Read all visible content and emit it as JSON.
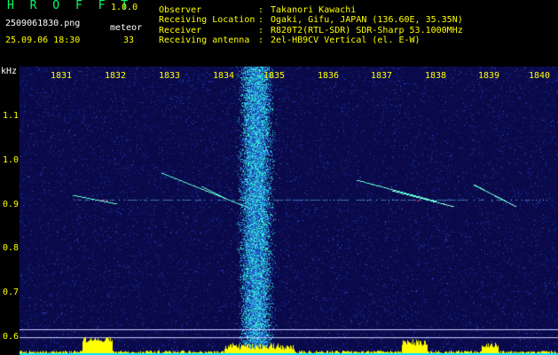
{
  "header": {
    "brand": "H R O F F T",
    "version": "1.0.0",
    "filename": "2509061830.png",
    "meteor_label": "meteor",
    "datetime": "25.09.06 18:30",
    "meteor_count": "33",
    "info": [
      {
        "key": "Observer",
        "value": "Takanori Kawachi"
      },
      {
        "key": "Receiving Location",
        "value": "Ogaki, Gifu, JAPAN (136.60E, 35.35N)"
      },
      {
        "key": "Receiver",
        "value": "R820T2(RTL-SDR) SDR-Sharp 53.1000MHz"
      },
      {
        "key": "Receiving antenna",
        "value": "2el-HB9CV Vertical (el. E-W)"
      }
    ],
    "colon": ":"
  },
  "spectrogram": {
    "unit": "kHz",
    "time_ticks": [
      "1831",
      "1832",
      "1833",
      "1834",
      "1835",
      "1836",
      "1837",
      "1838",
      "1839",
      "1840"
    ],
    "freq_ticks": [
      "1.1",
      "1.0",
      "0.9",
      "0.8",
      "0.7",
      "0.6"
    ],
    "colors": {
      "background": "#0a0a4a",
      "noise": "#1a2a9a",
      "signal": "#33ffcc",
      "peak": "#ff3366",
      "scale_text": "#ffff00",
      "histogram": "#ffff00",
      "baseline": "#00e0ff"
    }
  }
}
